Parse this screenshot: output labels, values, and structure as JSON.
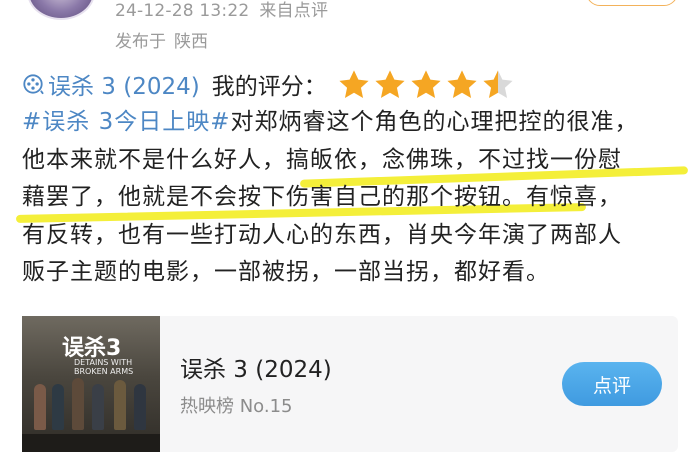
{
  "post": {
    "datetime": "24-12-28 13:22",
    "source": "来自点评",
    "published_label": "发布于",
    "location": "陕西"
  },
  "rating": {
    "movie_link": "误杀 3 (2024)",
    "label": "我的评分：",
    "stars_value": 4.5,
    "stars_max": 5,
    "star_color": "#f5a623",
    "star_empty_color": "#d9d9d9"
  },
  "review": {
    "hashtag": "#误杀 3今日上映#",
    "line1_rest": "对郑炳睿这个角色的心理把控的很准，",
    "line2": "他本来就不是什么好人，搞皈依，念佛珠，不过找一份慰",
    "line3": "藉罢了，他就是不会按下伤害自己的那个按钮。有惊喜，",
    "line4": "有反转，也有一些打动人心的东西，肖央今年演了两部人",
    "line5": "贩子主题的电影，一部被拐，一部当拐，都好看。",
    "highlight_color": "#f4ef3a"
  },
  "movie_card": {
    "title": "误杀 3 (2024)",
    "subtitle": "热映榜 No.15",
    "button_label": "点评",
    "poster_title": "误杀3",
    "poster_subtitle": "DETAINS WITH BROKEN ARMS"
  },
  "colors": {
    "link_blue": "#4d87c4",
    "button_blue": "#3f9ae0",
    "meta_gray": "#9a9a9a"
  }
}
